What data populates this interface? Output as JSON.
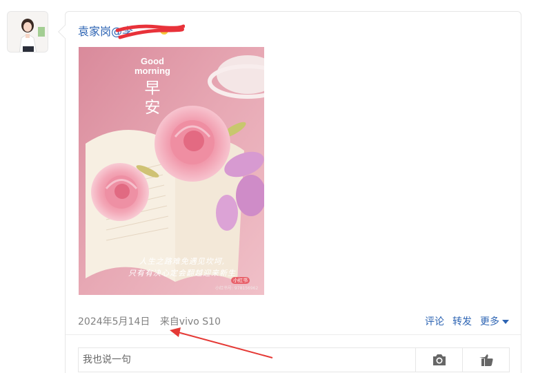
{
  "post": {
    "author": "袁家岗@李",
    "image_text": {
      "greeting_line1": "Good",
      "greeting_line2": "morning",
      "zao_char": "早",
      "an_char": "安",
      "poem_line1": "人生之路难免遇见坎坷,",
      "poem_line2": "只有有决心定会翻越迎来新生",
      "tag": "小红书",
      "account_id": "小红书号: 978156962"
    },
    "date": "2024年5月14日",
    "source": "来自vivo S10"
  },
  "actions": {
    "comment": "评论",
    "repost": "转发",
    "more": "更多"
  },
  "comment_box": {
    "placeholder": "我也说一句"
  },
  "icons": {
    "camera": "camera-icon",
    "like": "thumb-up-icon",
    "more": "caret-down-icon"
  },
  "colors": {
    "link_blue": "#2d64b3",
    "meta_gray": "#808080",
    "annotation_red": "#e53935"
  }
}
